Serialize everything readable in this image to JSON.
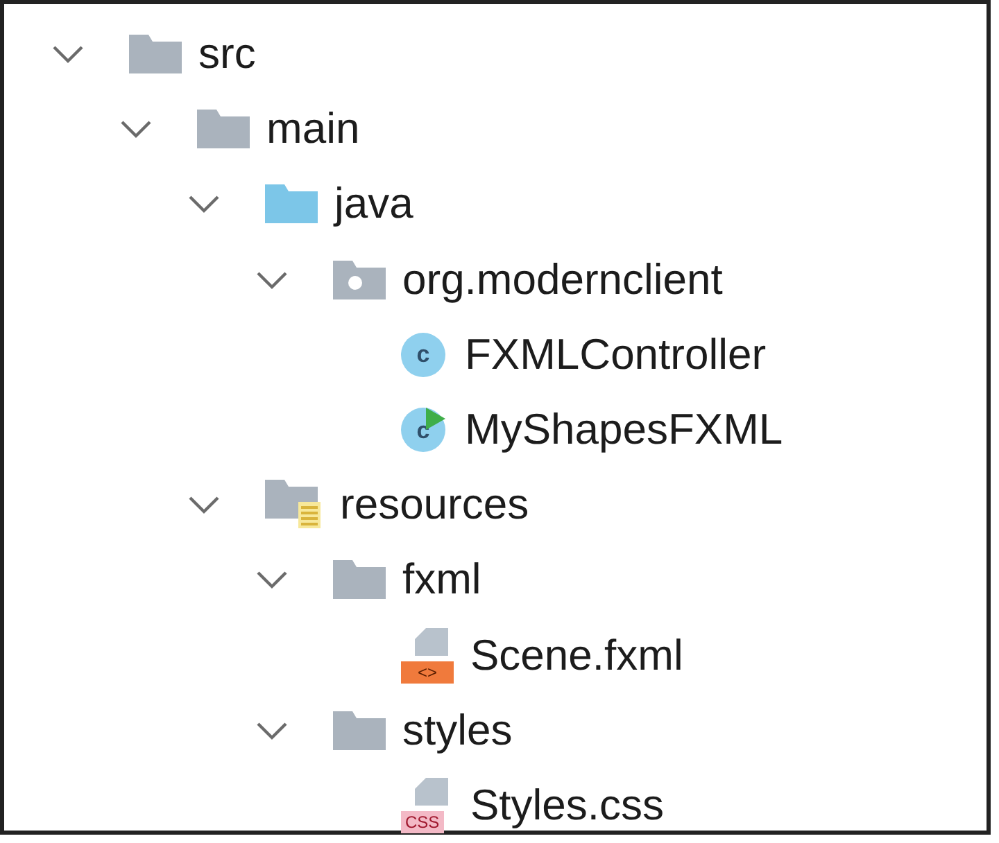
{
  "tree": [
    {
      "name": "src",
      "kind": "folder",
      "expanded": true,
      "children": [
        {
          "name": "main",
          "kind": "folder",
          "expanded": true,
          "children": [
            {
              "name": "java",
              "kind": "source-folder",
              "expanded": true,
              "children": [
                {
                  "name": "org.modernclient",
                  "kind": "package",
                  "expanded": true,
                  "children": [
                    {
                      "name": "FXMLController",
                      "kind": "class",
                      "badge": "c"
                    },
                    {
                      "name": "MyShapesFXML",
                      "kind": "main-class",
                      "badge": "c"
                    }
                  ]
                }
              ]
            },
            {
              "name": "resources",
              "kind": "resources",
              "expanded": true,
              "children": [
                {
                  "name": "fxml",
                  "kind": "folder",
                  "expanded": true,
                  "children": [
                    {
                      "name": "Scene.fxml",
                      "kind": "fxml",
                      "badge": "<>"
                    }
                  ]
                },
                {
                  "name": "styles",
                  "kind": "folder",
                  "expanded": true,
                  "children": [
                    {
                      "name": "Styles.css",
                      "kind": "css",
                      "badge": "CSS"
                    }
                  ]
                }
              ]
            }
          ]
        }
      ]
    }
  ]
}
